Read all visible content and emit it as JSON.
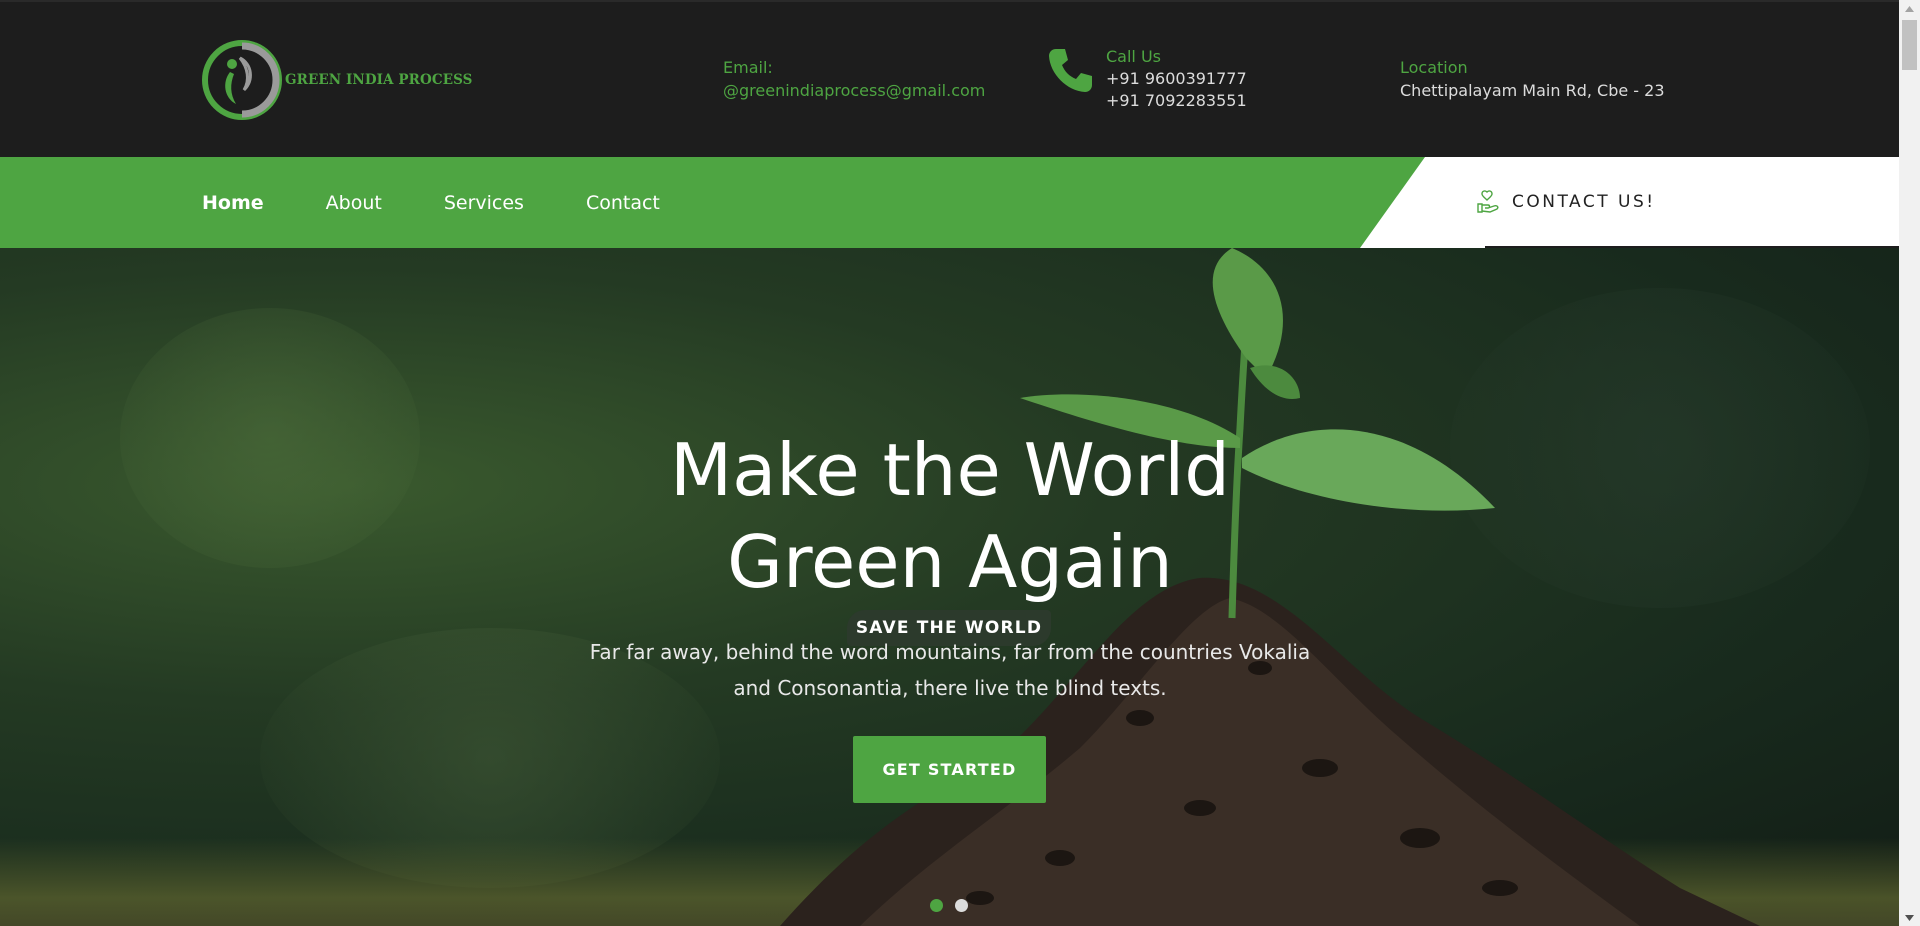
{
  "brand": {
    "name": "GREEN INDIA PROCESS",
    "logo_icon": "leaf-person-logo-icon"
  },
  "contact_info": {
    "email": {
      "label": "Email:",
      "value": "@greenindiaprocess@gmail.com"
    },
    "call": {
      "label": "Call Us",
      "phone1": "+91 9600391777",
      "phone2": "+91 7092283551",
      "icon": "phone-icon"
    },
    "location": {
      "label": "Location",
      "value": "Chettipalayam Main Rd, Cbe - 23"
    }
  },
  "nav": {
    "items": [
      {
        "label": "Home",
        "active": true
      },
      {
        "label": "About",
        "active": false
      },
      {
        "label": "Services",
        "active": false
      },
      {
        "label": "Contact",
        "active": false
      }
    ],
    "contact_button": {
      "label": "CONTACT US!",
      "icon": "hand-heart-icon"
    }
  },
  "hero": {
    "badge": "SAVE THE WORLD",
    "headline_line1": "Make the World",
    "headline_line2": "Green Again",
    "subtext_line1": "Far far away, behind the word mountains, far from the countries Vokalia",
    "subtext_line2": "and Consonantia, there live the blind texts.",
    "cta_label": "GET STARTED",
    "slides": {
      "count": 2,
      "active": 1
    }
  },
  "colors": {
    "accent_green": "#4ea542",
    "topbar_bg": "#1d1d1d",
    "text_light": "#dcdcdc"
  }
}
